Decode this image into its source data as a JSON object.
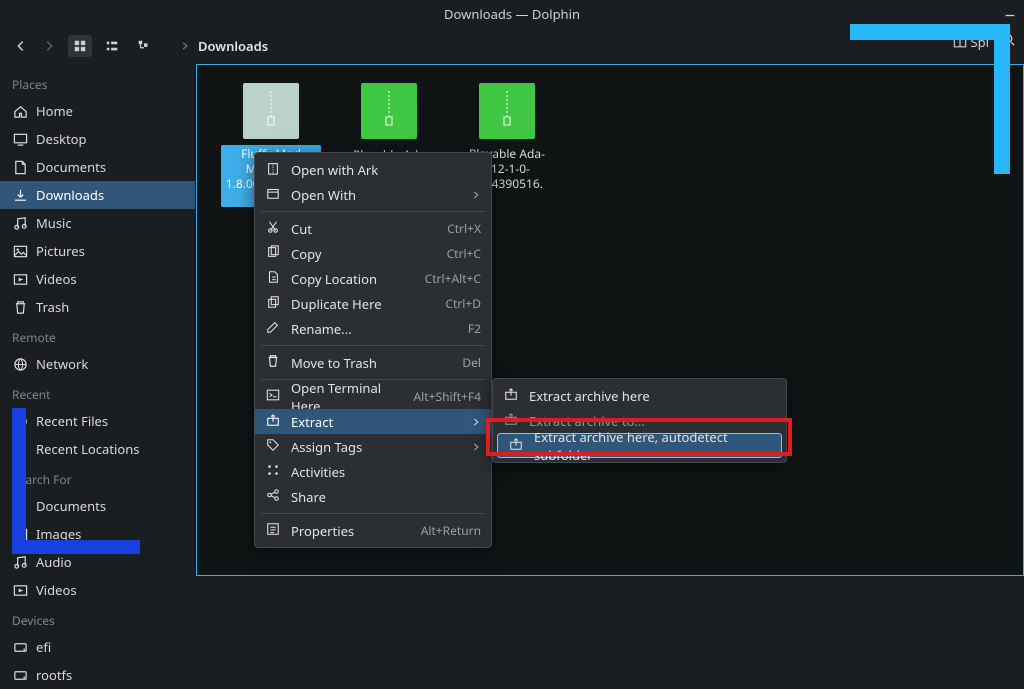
{
  "window": {
    "title": "Downloads — Dolphin"
  },
  "breadcrumb": {
    "current": "Downloads"
  },
  "toolbar_right": {
    "split": "Spl"
  },
  "sidebar": {
    "sections": [
      {
        "title": "Places",
        "items": [
          {
            "icon": "home",
            "label": "Home"
          },
          {
            "icon": "desktop",
            "label": "Desktop"
          },
          {
            "icon": "doc",
            "label": "Documents"
          },
          {
            "icon": "download",
            "label": "Downloads",
            "active": true
          },
          {
            "icon": "music",
            "label": "Music"
          },
          {
            "icon": "pictures",
            "label": "Pictures"
          },
          {
            "icon": "videos",
            "label": "Videos"
          },
          {
            "icon": "trash",
            "label": "Trash"
          }
        ]
      },
      {
        "title": "Remote",
        "items": [
          {
            "icon": "network",
            "label": "Network"
          }
        ]
      },
      {
        "title": "Recent",
        "items": [
          {
            "icon": "recentfiles",
            "label": "Recent Files"
          },
          {
            "icon": "recentloc",
            "label": "Recent Locations"
          }
        ]
      },
      {
        "title": "Search For",
        "items": [
          {
            "icon": "doc",
            "label": "Documents"
          },
          {
            "icon": "pictures",
            "label": "Images"
          },
          {
            "icon": "music",
            "label": "Audio"
          },
          {
            "icon": "videos",
            "label": "Videos"
          }
        ]
      },
      {
        "title": "Devices",
        "items": [
          {
            "icon": "disk",
            "label": "efi"
          },
          {
            "icon": "disk",
            "label": "rootfs"
          }
        ]
      }
    ]
  },
  "files": [
    {
      "name": "Fluffy Mod Manager 1.8.005-818-1-8-005",
      "selected": true,
      "variant": "z1"
    },
    {
      "name": "Playable Ada",
      "selected": false,
      "variant": "z2"
    },
    {
      "name": "Playable Ada-312-1-0-1554390516.",
      "selected": false,
      "variant": "z2"
    }
  ],
  "ctx": {
    "items": [
      {
        "icon": "ark",
        "label": "Open with Ark"
      },
      {
        "icon": "open",
        "label": "Open With",
        "submenu": true
      },
      {
        "sep": true
      },
      {
        "icon": "cut",
        "label": "Cut",
        "shortcut": "Ctrl+X"
      },
      {
        "icon": "copy",
        "label": "Copy",
        "shortcut": "Ctrl+C"
      },
      {
        "icon": "copyloc",
        "label": "Copy Location",
        "shortcut": "Ctrl+Alt+C"
      },
      {
        "icon": "dup",
        "label": "Duplicate Here",
        "shortcut": "Ctrl+D"
      },
      {
        "icon": "rename",
        "label": "Rename...",
        "shortcut": "F2"
      },
      {
        "sep": true
      },
      {
        "icon": "trash",
        "label": "Move to Trash",
        "shortcut": "Del"
      },
      {
        "sep": true
      },
      {
        "icon": "terminal",
        "label": "Open Terminal Here",
        "shortcut": "Alt+Shift+F4"
      },
      {
        "icon": "extract",
        "label": "Extract",
        "submenu": true,
        "highlight": true
      },
      {
        "icon": "tag",
        "label": "Assign Tags",
        "submenu": true
      },
      {
        "icon": "activities",
        "label": "Activities"
      },
      {
        "icon": "share",
        "label": "Share"
      },
      {
        "sep": true
      },
      {
        "icon": "props",
        "label": "Properties",
        "shortcut": "Alt+Return"
      }
    ]
  },
  "sub": {
    "items": [
      {
        "icon": "extract",
        "label": "Extract archive here"
      },
      {
        "icon": "extractto",
        "label": "Extract archive to...",
        "dim": true
      },
      {
        "icon": "extract",
        "label": "Extract archive here, autodetect subfolder",
        "framed": true
      }
    ]
  }
}
